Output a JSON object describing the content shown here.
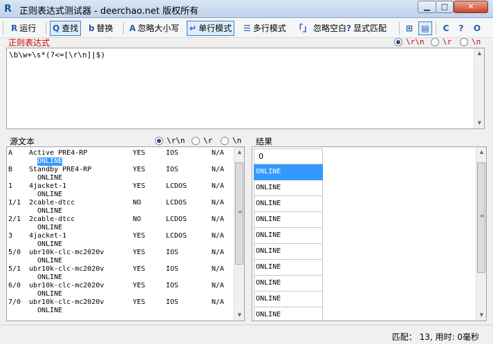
{
  "window": {
    "icon_glyph": "R",
    "title": "正则表达式测试器 - deerchao.net 版权所有",
    "min_glyph": "▁",
    "max_glyph": "□",
    "close_glyph": "✕"
  },
  "toolbar": {
    "run": "运行",
    "find": "查找",
    "replace": "替换",
    "ignore_case": "忽略大小写",
    "single_line": "单行模式",
    "multi_line": "多行模式",
    "ignore_whitespace": "忽略空白",
    "explicit_capture": "显式匹配"
  },
  "regex_panel": {
    "label": "正则表达式",
    "pattern": "\\b\\w+\\s*(?<=[\\r\\n]|$)",
    "newline_options": [
      "\\r\\n",
      "\\r",
      "\\n"
    ],
    "selected_newline": "\\r\\n"
  },
  "source_panel": {
    "label": "源文本",
    "newline_options": [
      "\\r\\n",
      "\\r",
      "\\n"
    ],
    "rows": [
      {
        "id": "A",
        "name": "Active PRE4-RP",
        "flag": "YES",
        "os": "IOS",
        "na": "N/A",
        "state": "ONLINE",
        "highlight": true
      },
      {
        "id": "B",
        "name": "Standby PRE4-RP",
        "flag": "YES",
        "os": "IOS",
        "na": "N/A",
        "state": "ONLINE"
      },
      {
        "id": "1",
        "name": "4jacket-1",
        "flag": "YES",
        "os": "LCDOS",
        "na": "N/A",
        "state": "ONLINE"
      },
      {
        "id": "1/1",
        "name": "2cable-dtcc",
        "flag": "NO",
        "os": "LCDOS",
        "na": "N/A",
        "state": "ONLINE"
      },
      {
        "id": "2/1",
        "name": "2cable-dtcc",
        "flag": "NO",
        "os": "LCDOS",
        "na": "N/A",
        "state": "ONLINE"
      },
      {
        "id": "3",
        "name": "4jacket-1",
        "flag": "YES",
        "os": "LCDOS",
        "na": "N/A",
        "state": "ONLINE"
      },
      {
        "id": "5/0",
        "name": "ubr10k-clc-mc2020v",
        "flag": "YES",
        "os": "IOS",
        "na": "N/A",
        "state": "ONLINE"
      },
      {
        "id": "5/1",
        "name": "ubr10k-clc-mc2020v",
        "flag": "YES",
        "os": "IOS",
        "na": "N/A",
        "state": "ONLINE"
      },
      {
        "id": "6/0",
        "name": "ubr10k-clc-mc2020v",
        "flag": "YES",
        "os": "IOS",
        "na": "N/A",
        "state": "ONLINE"
      },
      {
        "id": "7/0",
        "name": "ubr10k-clc-mc2020v",
        "flag": "YES",
        "os": "IOS",
        "na": "N/A",
        "state": "ONLINE"
      }
    ]
  },
  "result_panel": {
    "label": "结果",
    "header": "0",
    "items": [
      "ONLINE",
      "ONLINE",
      "ONLINE",
      "ONLINE",
      "ONLINE",
      "ONLINE",
      "ONLINE",
      "ONLINE",
      "ONLINE",
      "ONLINE"
    ],
    "selected_index": 0
  },
  "status": {
    "text": "匹配： 13, 用时: 0毫秒"
  }
}
